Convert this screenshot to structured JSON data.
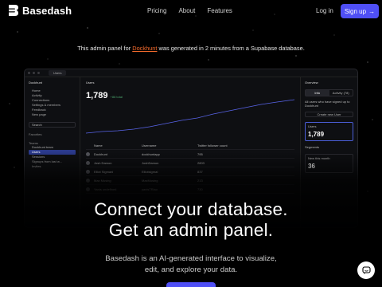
{
  "brand": {
    "name": "Basedash"
  },
  "nav": {
    "links": [
      "Pricing",
      "About",
      "Features"
    ],
    "login": "Log in",
    "signup": "Sign up",
    "signup_arrow": "→"
  },
  "tagline": {
    "before": "This admin panel for ",
    "link": "Dockhunt",
    "after": " was generated in 2 minutes from a Supabase database."
  },
  "app": {
    "tab": "Users",
    "workspace": "Dockhunt",
    "side_items": [
      "Home",
      "Activity",
      "Connections",
      "Settings & members",
      "Feedback",
      "New page"
    ],
    "search": "Search",
    "section_fav": "Favorites",
    "section_teams": "Teams",
    "team": "Dockhunt team",
    "users_item": "Users",
    "sub_items": [
      "Sessions",
      "Signups from last w...",
      "Invites"
    ],
    "panel_title": "Users",
    "metric": "1,789",
    "metric_delta": "+88 total",
    "columns": [
      "Name",
      "Username",
      "Twitter follower count"
    ],
    "rows": [
      [
        "Dockhunt",
        "dockhuntapp",
        "795"
      ],
      [
        "Josh Damon",
        "JoshDamon",
        "2803"
      ],
      [
        "Elliot Sigmani",
        "ElliotsigmaI",
        "837"
      ],
      [
        "Max Musing",
        "MaxMusing",
        "213"
      ],
      [
        "Yanis undefined",
        "yanisTRiao",
        "730"
      ]
    ],
    "right_title": "Overview",
    "right_tabs": [
      "Info",
      "Activity (78)"
    ],
    "right_desc": "All users who have signed up to Dockhunt",
    "right_actions": "Create new User",
    "card1_label": "Users",
    "card1_value": "1,789",
    "segments": "Segments",
    "card2_label": "New this month",
    "card2_value": "36"
  },
  "hero": {
    "line1": "Connect your database.",
    "line2": "Get an admin panel.",
    "sub1": "Basedash is an AI-generated interface to visualize,",
    "sub2": "edit, and explore your data."
  },
  "colors": {
    "accent": "#4f4ff5",
    "link": "#f36a2c",
    "background": "#000000"
  }
}
